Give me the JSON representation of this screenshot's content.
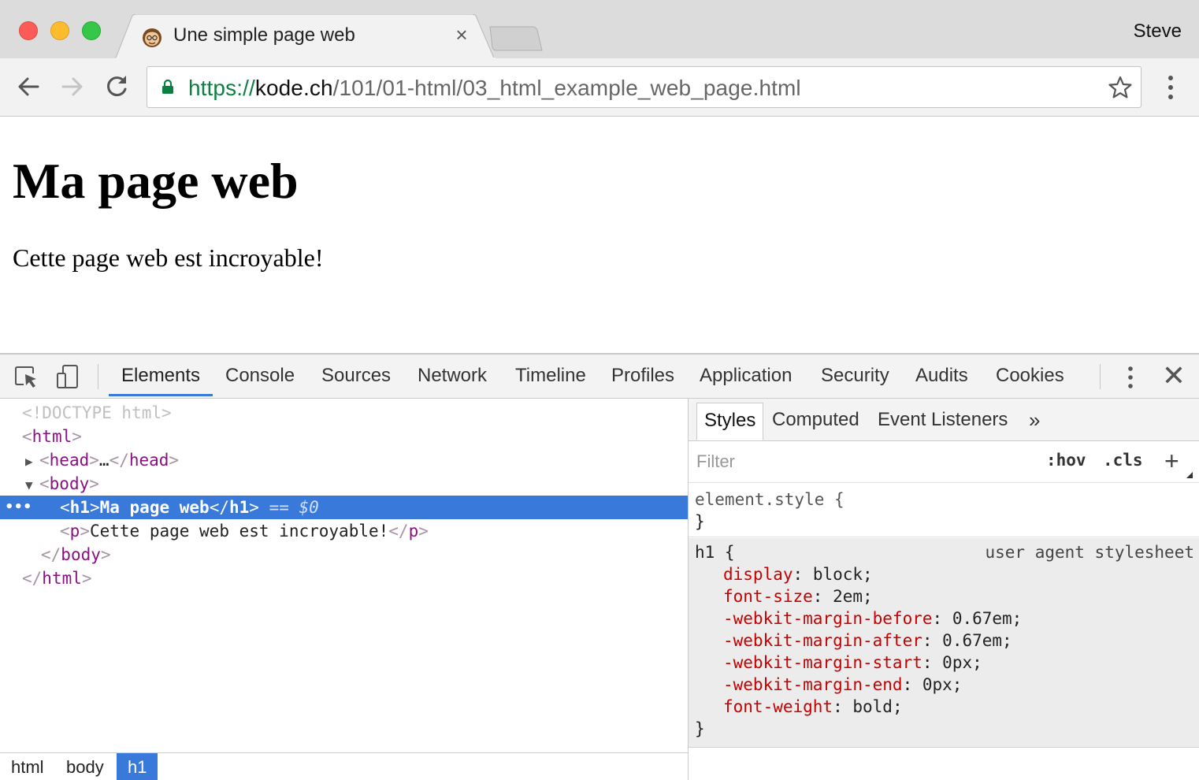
{
  "browser": {
    "tab": {
      "title": "Une simple page web",
      "close_glyph": "×"
    },
    "profile_name": "Steve",
    "url": {
      "scheme": "https://",
      "host": "kode.ch",
      "path": "/101/01-html/03_html_example_web_page.html"
    },
    "icons": [
      "back-arrow-icon",
      "forward-arrow-icon",
      "reload-icon",
      "lock-icon",
      "bookmark-star-icon",
      "menu-dots-icon"
    ]
  },
  "page": {
    "heading": "Ma page web",
    "paragraph": "Cette page web est incroyable!"
  },
  "devtools": {
    "tabs": [
      "Elements",
      "Console",
      "Sources",
      "Network",
      "Timeline",
      "Profiles",
      "Application",
      "Security",
      "Audits",
      "Cookies"
    ],
    "active_tab": "Elements",
    "close_glyph": "✕",
    "dom": {
      "doctype": "<!DOCTYPE html>",
      "html_open": "html",
      "head": "head",
      "head_ellipsis": "…",
      "body": "body",
      "h1_tag": "h1",
      "h1_text": "Ma page web",
      "eq_marker": "== $0",
      "p_tag": "p",
      "p_text": "Cette page web est incroyable!",
      "row_ellipsis": "•••"
    },
    "breadcrumbs": [
      "html",
      "body",
      "h1"
    ],
    "breadcrumb_active": "h1",
    "sidebar": {
      "tabs": [
        "Styles",
        "Computed",
        "Event Listeners"
      ],
      "more_glyph": "»",
      "filter_placeholder": "Filter",
      "hov": ":hov",
      "cls": ".cls",
      "plus": "+",
      "element_style_selector": "element.style {",
      "close_brace": "}",
      "rule_selector": "h1 {",
      "rule_origin": "user agent stylesheet",
      "declarations": [
        {
          "prop": "display",
          "value": "block;"
        },
        {
          "prop": "font-size",
          "value": "2em;"
        },
        {
          "prop": "-webkit-margin-before",
          "value": "0.67em;"
        },
        {
          "prop": "-webkit-margin-after",
          "value": "0.67em;"
        },
        {
          "prop": "-webkit-margin-start",
          "value": "0px;"
        },
        {
          "prop": "-webkit-margin-end",
          "value": "0px;"
        },
        {
          "prop": "font-weight",
          "value": "bold;"
        }
      ]
    }
  },
  "colors": {
    "selection_blue": "#3879d9",
    "secure_green": "#0b8043",
    "css_property_red": "#c80000",
    "dom_tag_purple": "#881280"
  }
}
